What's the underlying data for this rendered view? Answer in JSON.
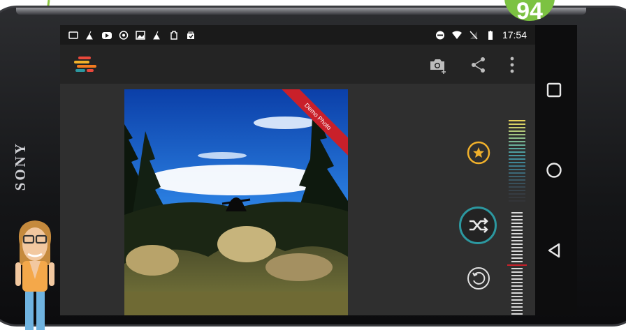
{
  "badge": {
    "number": "94",
    "color": "#7cc242"
  },
  "phone": {
    "brand": "SONY"
  },
  "status_bar": {
    "time": "17:54",
    "left_icons": [
      "phone-storage-icon",
      "cleaner-icon",
      "youtube-icon",
      "vpn-icon",
      "gallery-icon",
      "cleaner-icon",
      "battery-saver-icon",
      "shopping-bag-icon"
    ],
    "right_icons": [
      "do-not-disturb-icon",
      "wifi-icon",
      "no-sim-icon",
      "battery-icon"
    ]
  },
  "action_bar": {
    "logo": "app-logo-stripes-icon",
    "actions": [
      "camera-add-icon",
      "share-icon",
      "overflow-menu-icon"
    ]
  },
  "photo": {
    "ribbon_text": "Demo Photo",
    "ribbon_color": "#c9202a"
  },
  "controls": {
    "favorite": {
      "icon": "star-icon",
      "color": "#f1b12b"
    },
    "shuffle": {
      "icon": "shuffle-icon",
      "color": "#2c98a0"
    },
    "undo": {
      "icon": "undo-icon",
      "color": "#e0e0e0"
    }
  },
  "nav_bar": {
    "buttons": [
      "recents-square-icon",
      "home-circle-icon",
      "back-triangle-icon"
    ]
  }
}
